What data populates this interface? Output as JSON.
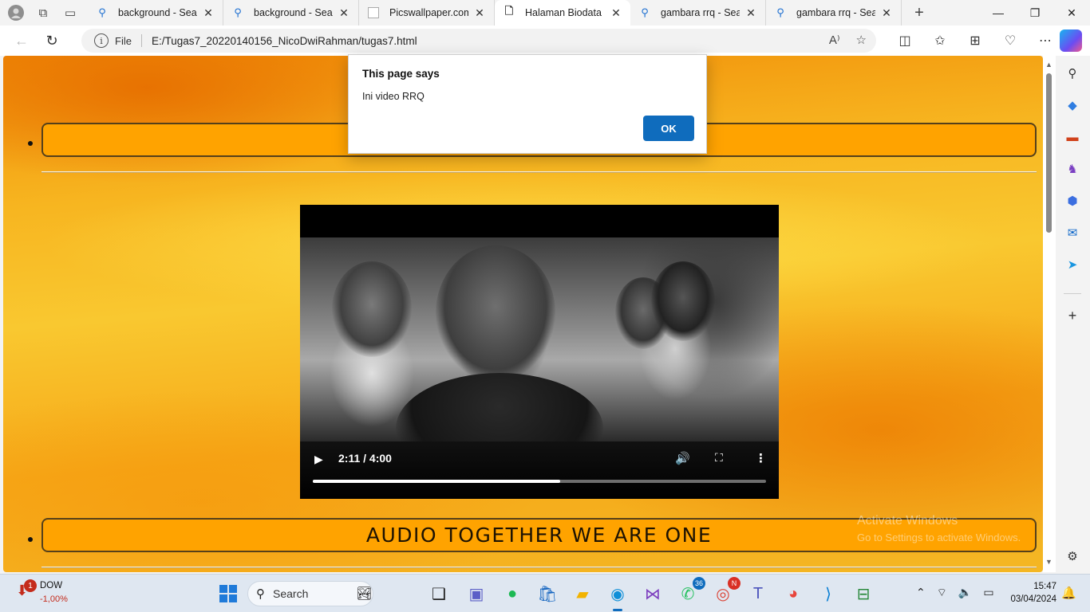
{
  "browser": {
    "tabs": [
      {
        "title": "background - Search",
        "icon": "search-icon"
      },
      {
        "title": "background - Search",
        "icon": "search-icon"
      },
      {
        "title": "Picswallpaper.com",
        "icon": "blank-page-icon"
      },
      {
        "title": "Halaman Biodata",
        "icon": "page-icon",
        "active": true
      },
      {
        "title": "gambara rrq - Search",
        "icon": "search-icon"
      },
      {
        "title": "gambara rrq - Search",
        "icon": "search-icon"
      }
    ],
    "address": {
      "scheme_label": "File",
      "url": "E:/Tugas7_20220140156_NicoDwiRahman/tugas7.html"
    }
  },
  "page": {
    "section2_title": "AUDIO TOGETHER WE ARE ONE",
    "video": {
      "time": "2:11 / 4:00",
      "progress": 0.545
    }
  },
  "dialog": {
    "title": "This page says",
    "message": "Ini video RRQ",
    "ok_label": "OK"
  },
  "watermark": {
    "title": "Activate Windows",
    "subtitle": "Go to Settings to activate Windows."
  },
  "taskbar": {
    "stock": {
      "name": "DOW",
      "change": "-1,00%",
      "badge": "1"
    },
    "search_label": "Search",
    "whatsapp_count": "36",
    "chrome_badge": "N",
    "time": "15:47",
    "date": "03/04/2024"
  },
  "colors": {
    "accent": "#0f6cbd",
    "nav_item_bg": "#ffa300",
    "nav_item_border": "#55401a"
  }
}
